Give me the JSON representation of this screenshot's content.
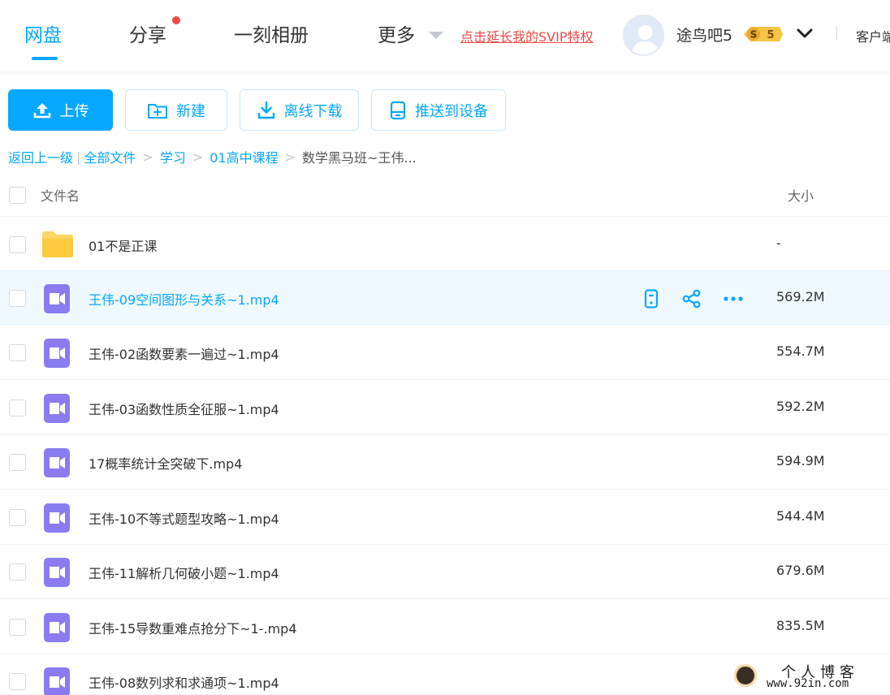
{
  "nav": {
    "tabs": [
      {
        "label": "网盘"
      },
      {
        "label": "分享"
      },
      {
        "label": "一刻相册"
      },
      {
        "label": "更多"
      }
    ],
    "svip_link": "点击延长我的SVIP特权",
    "username": "途鸟吧5",
    "vip_level": "5",
    "vip_letter": "S",
    "client_link": "客户端",
    "accent_color": "#06a7ff",
    "notice_color": "#f04848"
  },
  "toolbar": {
    "upload_label": "上传",
    "new_label": "新建",
    "offline_label": "离线下载",
    "push_label": "推送到设备"
  },
  "breadcrumb": {
    "back": "返回上一级",
    "items": [
      "全部文件",
      "学习",
      "01高中课程"
    ],
    "current": "数学黑马班~王伟..."
  },
  "list": {
    "header_name": "文件名",
    "header_size": "大小",
    "files": [
      {
        "name": "01不是正课",
        "size": "-",
        "type": "folder-icon"
      },
      {
        "name": "王伟-09空间图形与关系~1.mp4",
        "size": "569.2M",
        "type": "video-file-icon",
        "hovered": true
      },
      {
        "name": "王伟-02函数要素一遍过~1.mp4",
        "size": "554.7M",
        "type": "video-file-icon"
      },
      {
        "name": "王伟-03函数性质全征服~1.mp4",
        "size": "592.2M",
        "type": "video-file-icon"
      },
      {
        "name": "17概率统计全突破下.mp4",
        "size": "594.9M",
        "type": "video-file-icon"
      },
      {
        "name": "王伟-10不等式题型攻略~1.mp4",
        "size": "544.4M",
        "type": "video-file-icon"
      },
      {
        "name": "王伟-11解析几何破小题~1.mp4",
        "size": "679.6M",
        "type": "video-file-icon"
      },
      {
        "name": "王伟-15导数重难点抢分下~1-.mp4",
        "size": "835.5M",
        "type": "video-file-icon"
      },
      {
        "name": "王伟-08数列求和求通项~1.mp4",
        "size": "",
        "type": "video-file-icon"
      }
    ]
  },
  "watermark": {
    "title": "个人博客",
    "url": "www.92in.com"
  }
}
